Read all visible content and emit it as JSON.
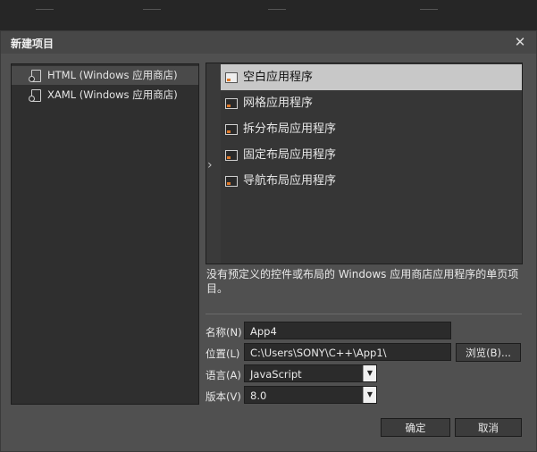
{
  "dialog": {
    "title": "新建项目",
    "close_glyph": "✕"
  },
  "left_tree": {
    "items": [
      {
        "label": "HTML (Windows 应用商店)",
        "icon": "file-icon",
        "selected": true
      },
      {
        "label": "XAML (Windows 应用商店)",
        "icon": "file-icon",
        "selected": false
      }
    ]
  },
  "templates": {
    "expand_glyph": "›",
    "items": [
      {
        "label": "空白应用程序",
        "selected": true
      },
      {
        "label": "网格应用程序",
        "selected": false
      },
      {
        "label": "拆分布局应用程序",
        "selected": false
      },
      {
        "label": "固定布局应用程序",
        "selected": false
      },
      {
        "label": "导航布局应用程序",
        "selected": false
      }
    ]
  },
  "description": "没有预定义的控件或布局的 Windows 应用商店应用程序的单页项目。",
  "form": {
    "name_label": "名称(N)",
    "name_value": "App4",
    "location_label": "位置(L)",
    "location_value": "C:\\Users\\SONY\\C++\\App1\\",
    "browse_label": "浏览(B)...",
    "language_label": "语言(A)",
    "language_value": "JavaScript",
    "version_label": "版本(V)",
    "version_value": "8.0",
    "dropdown_glyph": "▼"
  },
  "buttons": {
    "ok_label": "确定",
    "cancel_label": "取消"
  },
  "colors": {
    "selection": "#c8c8c8",
    "accent_icon": "#e07a2a"
  }
}
